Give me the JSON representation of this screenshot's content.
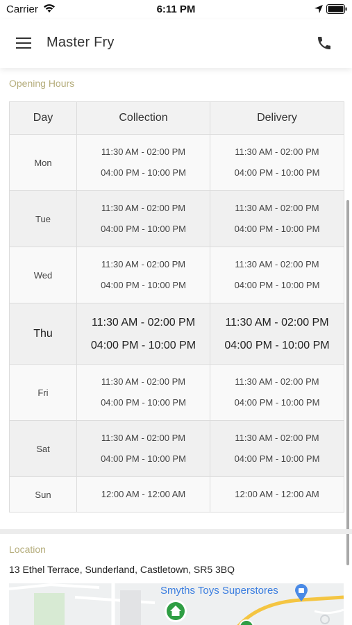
{
  "status_bar": {
    "carrier": "Carrier",
    "time": "6:11 PM"
  },
  "header": {
    "title": "Master Fry",
    "menu_icon": "hamburger-menu-icon",
    "phone_icon": "phone-icon"
  },
  "opening_hours": {
    "title": "Opening Hours",
    "columns": [
      "Day",
      "Collection",
      "Delivery"
    ],
    "rows": [
      {
        "day": "Mon",
        "collection": [
          "11:30 AM - 02:00 PM",
          "04:00 PM - 10:00 PM"
        ],
        "delivery": [
          "11:30 AM - 02:00 PM",
          "04:00 PM - 10:00 PM"
        ]
      },
      {
        "day": "Tue",
        "collection": [
          "11:30 AM - 02:00 PM",
          "04:00 PM - 10:00 PM"
        ],
        "delivery": [
          "11:30 AM - 02:00 PM",
          "04:00 PM - 10:00 PM"
        ]
      },
      {
        "day": "Wed",
        "collection": [
          "11:30 AM - 02:00 PM",
          "04:00 PM - 10:00 PM"
        ],
        "delivery": [
          "11:30 AM - 02:00 PM",
          "04:00 PM - 10:00 PM"
        ]
      },
      {
        "day": "Thu",
        "collection": [
          "11:30 AM - 02:00 PM",
          "04:00 PM - 10:00 PM"
        ],
        "delivery": [
          "11:30 AM - 02:00 PM",
          "04:00 PM - 10:00 PM"
        ]
      },
      {
        "day": "Fri",
        "collection": [
          "11:30 AM - 02:00 PM",
          "04:00 PM - 10:00 PM"
        ],
        "delivery": [
          "11:30 AM - 02:00 PM",
          "04:00 PM - 10:00 PM"
        ]
      },
      {
        "day": "Sat",
        "collection": [
          "11:30 AM - 02:00 PM",
          "04:00 PM - 10:00 PM"
        ],
        "delivery": [
          "11:30 AM - 02:00 PM",
          "04:00 PM - 10:00 PM"
        ]
      },
      {
        "day": "Sun",
        "collection": [
          "12:00 AM - 12:00 AM"
        ],
        "delivery": [
          "12:00 AM - 12:00 AM"
        ]
      }
    ]
  },
  "location": {
    "title": "Location",
    "address": "13 Ethel Terrace, Sunderland, Castletown, SR5 3BQ",
    "map_label": "Smyths Toys Superstores"
  },
  "colors": {
    "section_title": "#b5ad7c",
    "map_label": "#3a7de0",
    "home_marker": "#2f9e44"
  }
}
